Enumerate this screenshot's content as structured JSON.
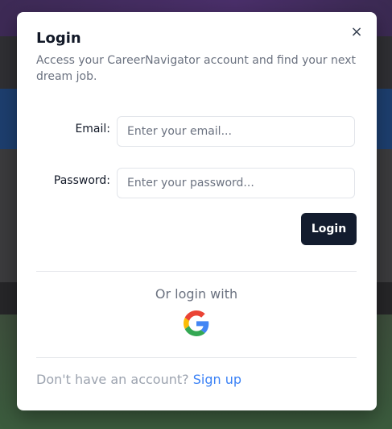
{
  "modal": {
    "title": "Login",
    "subtitle": "Access your CareerNavigator account and find your next dream job.",
    "close_glyph": "×"
  },
  "form": {
    "email_label": "Email:",
    "email_placeholder": "Enter your email...",
    "email_value": "",
    "password_label": "Password:",
    "password_placeholder": "Enter your password...",
    "password_value": "",
    "submit_label": "Login"
  },
  "social": {
    "or_text": "Or login with",
    "provider_icon": "google-icon"
  },
  "footer": {
    "prompt": "Don't have an account?",
    "signup_link": "Sign up"
  },
  "colors": {
    "primary_button": "#131c2e",
    "link": "#3b82f6",
    "muted_text": "#6b7280"
  }
}
